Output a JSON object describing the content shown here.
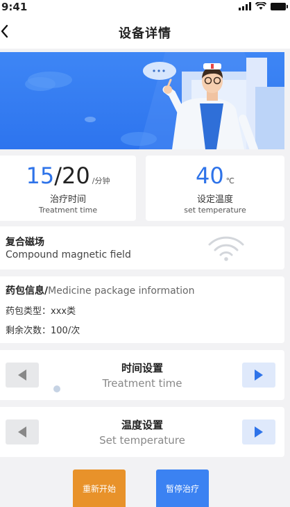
{
  "status_bar": {
    "time": "9:41"
  },
  "nav": {
    "title": "设备详情"
  },
  "treatment_time": {
    "value": "15",
    "separator": "/",
    "total": "20",
    "unit": "/分钟",
    "label_cn": "治疗时间",
    "label_en": "Treatment time"
  },
  "temperature": {
    "value": "40",
    "unit": "℃",
    "label_cn": "设定温度",
    "label_en": "set temperature"
  },
  "magnetic": {
    "label_cn": "复合磁场",
    "label_en": "Compound magnetic field"
  },
  "medicine": {
    "title_cn": "药包信息/",
    "title_en": "Medicine package information",
    "type": "药包类型：xxx类",
    "remaining": "剩余次数：100/次"
  },
  "time_setting": {
    "label_cn": "时间设置",
    "label_en": "Treatment time"
  },
  "temp_setting": {
    "label_cn": "温度设置",
    "label_en": "Set temperature"
  },
  "actions": {
    "restart": "重新开始",
    "pause": "暂停治疗"
  },
  "colors": {
    "primary": "#2e73e9",
    "orange": "#e8922a",
    "banner": "#3e86f5"
  }
}
